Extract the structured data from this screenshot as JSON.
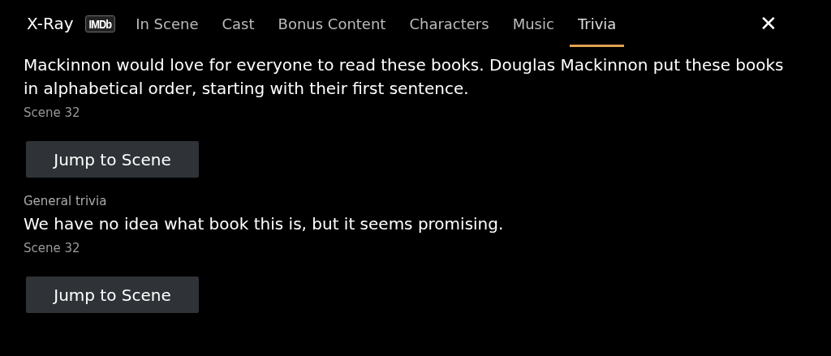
{
  "header": {
    "title": "X-Ray",
    "badge": "IMDb",
    "close": "✕"
  },
  "tabs": [
    {
      "label": "In Scene",
      "selected": false
    },
    {
      "label": "Cast",
      "selected": false
    },
    {
      "label": "Bonus Content",
      "selected": false
    },
    {
      "label": "Characters",
      "selected": false
    },
    {
      "label": "Music",
      "selected": false
    },
    {
      "label": "Trivia",
      "selected": true
    }
  ],
  "trivia": [
    {
      "text": "Mackinnon would love for everyone to read these books. Douglas Mackinnon put these books in alphabetical order, starting with their first sentence.",
      "scene": "Scene 32",
      "button": "Jump to Scene"
    },
    {
      "category": "General trivia",
      "text": "We have no idea what book this is, but it seems promising.",
      "scene": "Scene 32",
      "button": "Jump to Scene"
    }
  ]
}
